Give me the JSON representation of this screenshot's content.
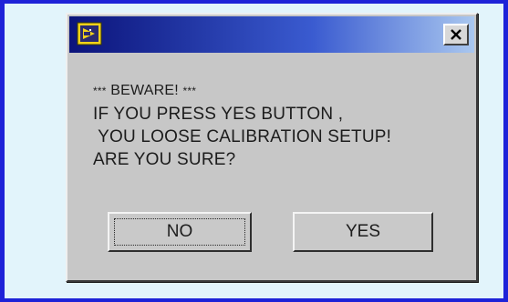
{
  "dialog": {
    "message": {
      "line1_stars_left": "***",
      "line1_text": " BEWARE! ",
      "line1_stars_right": "***",
      "line2": "IF YOU PRESS YES BUTTON ,",
      "line3": " YOU LOOSE CALIBRATION SETUP!",
      "line4": "ARE YOU SURE?"
    },
    "buttons": {
      "no_label": "NO",
      "yes_label": "YES"
    },
    "close_icon": "close-icon",
    "app_icon": "labview-app-icon"
  },
  "colors": {
    "outer_border": "#1e22d8",
    "panel_background": "#e2f4fb",
    "dialog_face": "#c7c7c7",
    "titlebar_start": "#0b137a",
    "titlebar_end": "#a9c7ef"
  }
}
